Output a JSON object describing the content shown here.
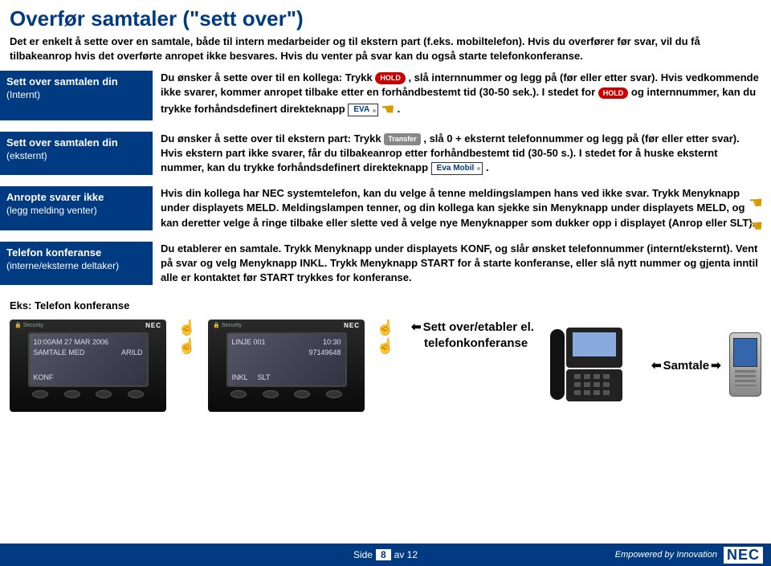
{
  "header": {
    "title": "Overfør samtaler (\"sett over\")",
    "description": "Det er enkelt å sette over en samtale, både til intern medarbeider og til ekstern part (f.eks. mobiltelefon). Hvis du overfører før svar, vil du få tilbakeanrop hvis det overførte anropet ikke besvares. Hvis du venter på svar kan du også starte telefonkonferanse."
  },
  "sections": {
    "intern": {
      "label_main": "Sett over samtalen din",
      "label_sub": "(Internt)",
      "body_pre": "Du ønsker å sette over til en kollega: Trykk ",
      "hold": "HOLD",
      "body_mid1": ", slå internnummer og legg på (før eller etter svar). Hvis vedkommende ikke svarer, kommer anropet tilbake etter en forhåndbestemt tid (30-50 sek.). I stedet for ",
      "body_mid2": " og internnummer, kan du trykke forhåndsdefinert direkteknapp",
      "eva": "EVA",
      "body_end": "."
    },
    "ekstern": {
      "label_main": "Sett over samtalen din",
      "label_sub": "(eksternt)",
      "body_pre": "Du ønsker å sette over til ekstern part: Trykk",
      "transfer": "Transfer",
      "body_mid1": ", slå 0 + eksternt telefonnummer og legg på (før eller etter svar). Hvis ekstern part ikke svarer, får du tilbakeanrop etter forhåndbestemt tid (30-50 s.). I stedet for å huske eksternt nummer, kan du trykke forhåndsdefinert direkteknapp ",
      "eva_mobil": "Eva Mobil",
      "body_end": "."
    },
    "anropte": {
      "label_main": "Anropte svarer ikke",
      "label_sub": "(legg melding venter)",
      "body": "Hvis din kollega har NEC systemtelefon, kan du velge å tenne meldingslampen hans ved ikke svar. Trykk Menyknapp under displayets MELD. Meldingslampen tenner, og din kollega kan sjekke sin Menyknapp under displayets MELD, og kan deretter velge å ringe tilbake eller slette ved å velge nye Menyknapper som dukker opp i displayet (Anrop eller SLT)."
    },
    "konferanse": {
      "label_main": "Telefon konferanse",
      "label_sub": "(interne/eksterne deltaker)",
      "body": "Du etablerer en samtale. Trykk Menyknapp under displayets KONF, og slår ønsket telefonnummer (internt/eksternt). Vent på svar og velg Menyknapp INKL. Trykk Menyknapp START for å starte konferanse, eller slå nytt nummer og gjenta inntil alle er kontaktet før START trykkes for konferanse."
    }
  },
  "example_label": "Eks: Telefon konferanse",
  "phones": {
    "left": {
      "security": "Security",
      "brand": "NEC",
      "line1": "10:00AM 27 MAR 2006",
      "line2a": "SAMTALE MED",
      "line2b": "ARILD",
      "bottom1": "KONF"
    },
    "right": {
      "security": "Security",
      "brand": "NEC",
      "line1a": "LINJE 001",
      "line1b": "10:30",
      "line2": "97149648",
      "bottom1": "INKL",
      "bottom2": "SLT"
    }
  },
  "captions": {
    "settover": "Sett over/etabler el.",
    "telekonf": "telefonkonferanse",
    "samtale": "Samtale"
  },
  "footer": {
    "side": "Side",
    "page": "8",
    "av": "av 12",
    "tagline": "Empowered by Innovation",
    "logo": "NEC"
  }
}
